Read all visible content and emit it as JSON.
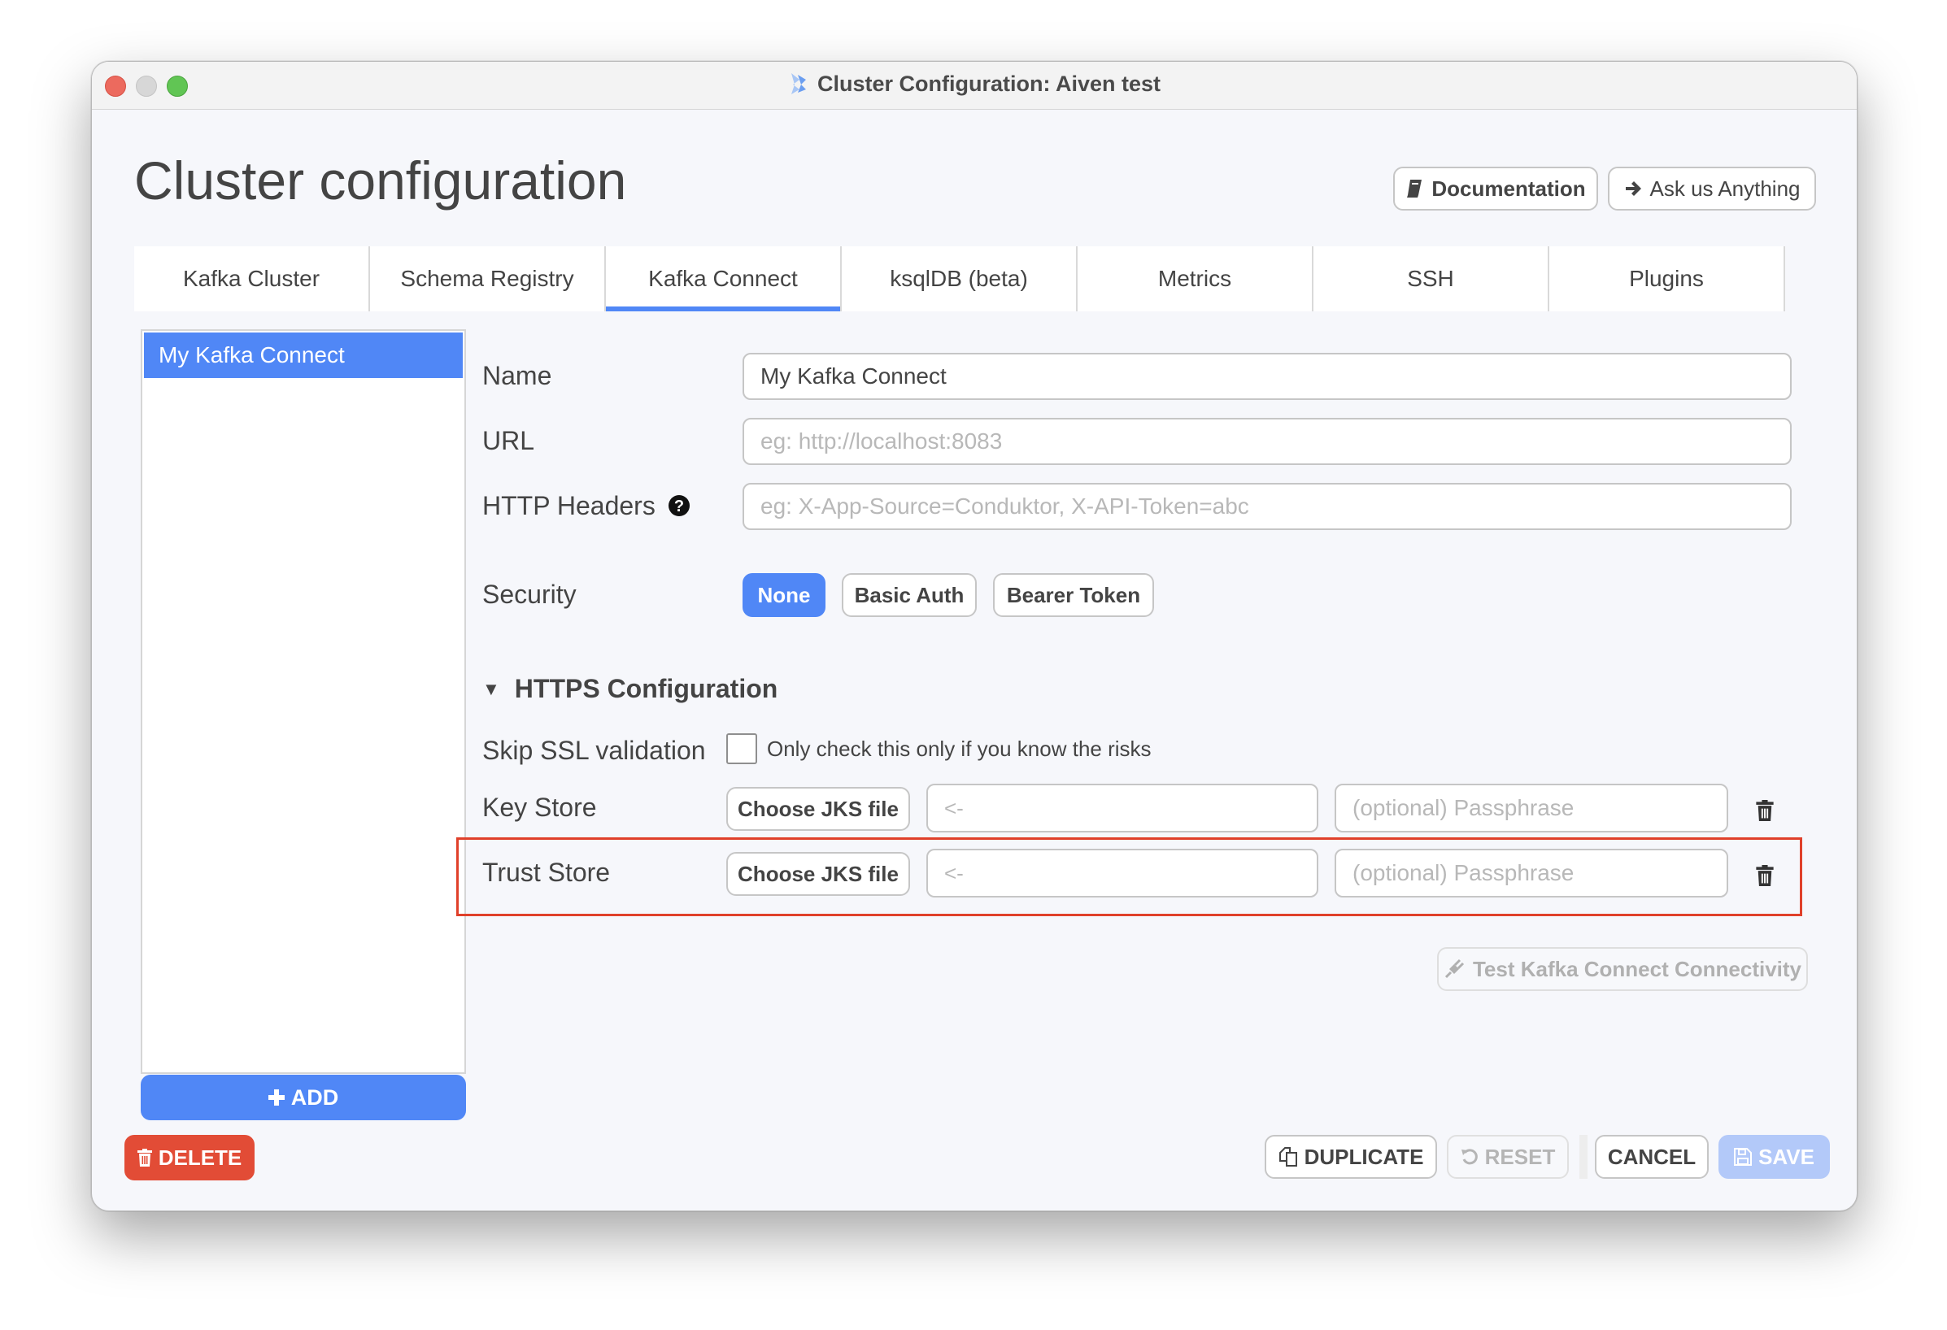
{
  "window": {
    "title": "Cluster Configuration: Aiven test"
  },
  "header": {
    "title": "Cluster configuration",
    "documentation_label": "Documentation",
    "ask_label": "Ask us Anything"
  },
  "tabs": [
    {
      "label": "Kafka Cluster",
      "active": false
    },
    {
      "label": "Schema Registry",
      "active": false
    },
    {
      "label": "Kafka Connect",
      "active": true
    },
    {
      "label": "ksqlDB (beta)",
      "active": false
    },
    {
      "label": "Metrics",
      "active": false
    },
    {
      "label": "SSH",
      "active": false
    },
    {
      "label": "Plugins",
      "active": false
    }
  ],
  "connect_list": {
    "items": [
      {
        "label": "My Kafka Connect",
        "selected": true
      }
    ],
    "add_label": "ADD",
    "delete_label": "DELETE"
  },
  "form": {
    "name": {
      "label": "Name",
      "value": "My Kafka Connect"
    },
    "url": {
      "label": "URL",
      "value": "",
      "placeholder": "eg: http://localhost:8083"
    },
    "headers": {
      "label": "HTTP Headers",
      "value": "",
      "placeholder": "eg: X-App-Source=Conduktor, X-API-Token=abc"
    },
    "security": {
      "label": "Security",
      "options": [
        "None",
        "Basic Auth",
        "Bearer Token"
      ],
      "selected": "None"
    }
  },
  "https": {
    "title": "HTTPS Configuration",
    "expanded": true,
    "skip_ssl": {
      "label": "Skip SSL validation",
      "checkbox_label": "Only check this only if you know the risks",
      "checked": false
    },
    "key_store": {
      "label": "Key Store",
      "choose_label": "Choose JKS file",
      "file_value": "",
      "file_placeholder": "<-",
      "pass_placeholder": "(optional) Passphrase"
    },
    "trust_store": {
      "label": "Trust Store",
      "choose_label": "Choose JKS file",
      "file_value": "",
      "file_placeholder": "<-",
      "pass_placeholder": "(optional) Passphrase"
    },
    "test_label": "Test Kafka Connect Connectivity"
  },
  "footer": {
    "duplicate_label": "DUPLICATE",
    "reset_label": "RESET",
    "cancel_label": "CANCEL",
    "save_label": "SAVE"
  },
  "colors": {
    "accent": "#5087f6",
    "danger": "#e24c36",
    "highlight": "#e0402a",
    "save_disabled": "#b3c9f9"
  }
}
